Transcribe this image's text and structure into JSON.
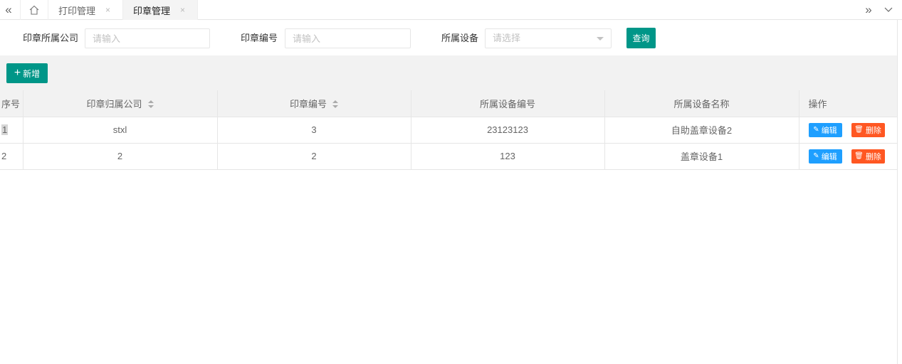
{
  "tabs": {
    "prev_icon": "«",
    "next_icon": "»",
    "dropdown_icon": "∨",
    "items": [
      {
        "label": "打印管理",
        "close": "×"
      },
      {
        "label": "印章管理",
        "close": "×"
      }
    ]
  },
  "search": {
    "company_label": "印章所属公司",
    "company_placeholder": "请输入",
    "code_label": "印章编号",
    "code_placeholder": "请输入",
    "device_label": "所属设备",
    "device_placeholder": "请选择",
    "query_label": "查询"
  },
  "toolbar": {
    "add_icon": "+",
    "add_label": "新增"
  },
  "table": {
    "headers": {
      "index": "序号",
      "company": "印章归属公司",
      "code": "印章编号",
      "device_code": "所属设备编号",
      "device_name": "所属设备名称",
      "ops": "操作"
    },
    "rows": [
      {
        "index": "1",
        "company": "stxl",
        "code": "3",
        "device_code": "23123123",
        "device_name": "自助盖章设备2"
      },
      {
        "index": "2",
        "company": "2",
        "code": "2",
        "device_code": "123",
        "device_name": "盖章设备1"
      }
    ],
    "edit_label": "编辑",
    "delete_label": "删除",
    "edit_icon": "✎",
    "delete_icon": "🗑"
  },
  "colors": {
    "primary": "#009688",
    "edit": "#1e9fff",
    "delete": "#ff5722"
  },
  "icons": {
    "home": "home-icon",
    "sort": "sort-icon",
    "caret": "caret-down-icon"
  }
}
